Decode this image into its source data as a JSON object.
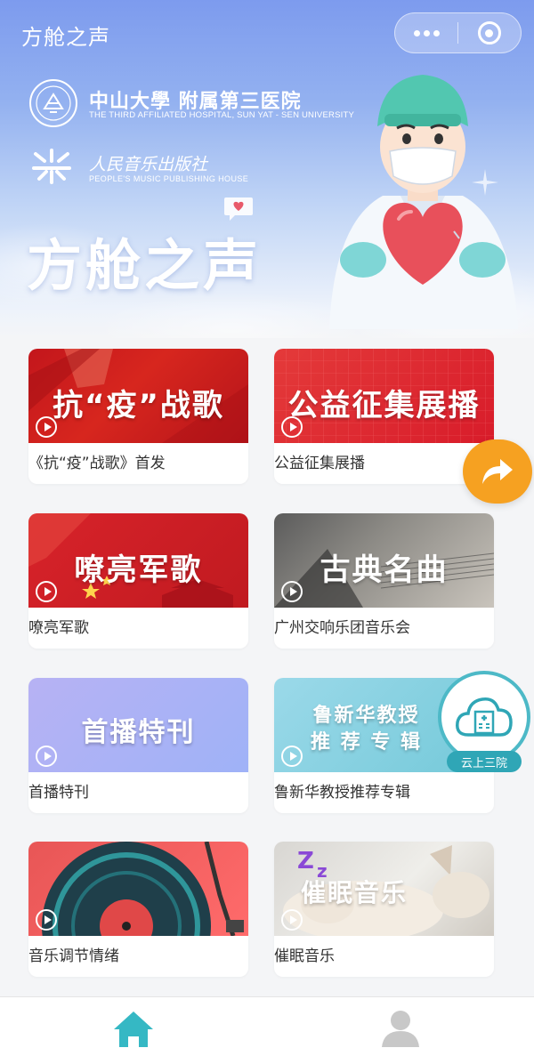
{
  "app": {
    "title": "方舱之声"
  },
  "capsule": {
    "more_icon": "more-dots-icon",
    "close_icon": "mini-program-close-icon"
  },
  "hero": {
    "hospital_name": "中山大學 附属第三医院",
    "hospital_en": "THE THIRD AFFILIATED HOSPITAL, SUN YAT - SEN UNIVERSITY",
    "publisher_name": "人民音乐出版社",
    "publisher_en": "PEOPLE'S MUSIC PUBLISHING HOUSE",
    "headline": "方舱之声"
  },
  "cards": [
    {
      "banner_text": "抗“疫”战歌",
      "caption": "《抗“疫”战歌》首发"
    },
    {
      "banner_text": "公益征集展播",
      "caption": "公益征集展播"
    },
    {
      "banner_text": "嘹亮军歌",
      "caption": "嘹亮军歌"
    },
    {
      "banner_text": "古典名曲",
      "caption": "广州交响乐团音乐会"
    },
    {
      "banner_text": "首播特刊",
      "caption": "首播特刊"
    },
    {
      "banner_text": "鲁新华教授\n推 荐 专 辑",
      "caption": "鲁新华教授推荐专辑"
    },
    {
      "banner_text": "",
      "caption": "音乐调节情绪"
    },
    {
      "banner_text": "催眠音乐",
      "caption": "催眠音乐"
    }
  ],
  "floating": {
    "share_icon": "share-arrow-icon",
    "cloud_label": "云上三院"
  },
  "tabbar": {
    "home_icon": "home-icon",
    "profile_icon": "user-icon",
    "active_color": "#35b8c4",
    "inactive_color": "#c8c8c8"
  },
  "colors": {
    "hero_top": "#7d9bee",
    "share_orange": "#f6a121",
    "cloud_teal": "#2fa6b6"
  }
}
